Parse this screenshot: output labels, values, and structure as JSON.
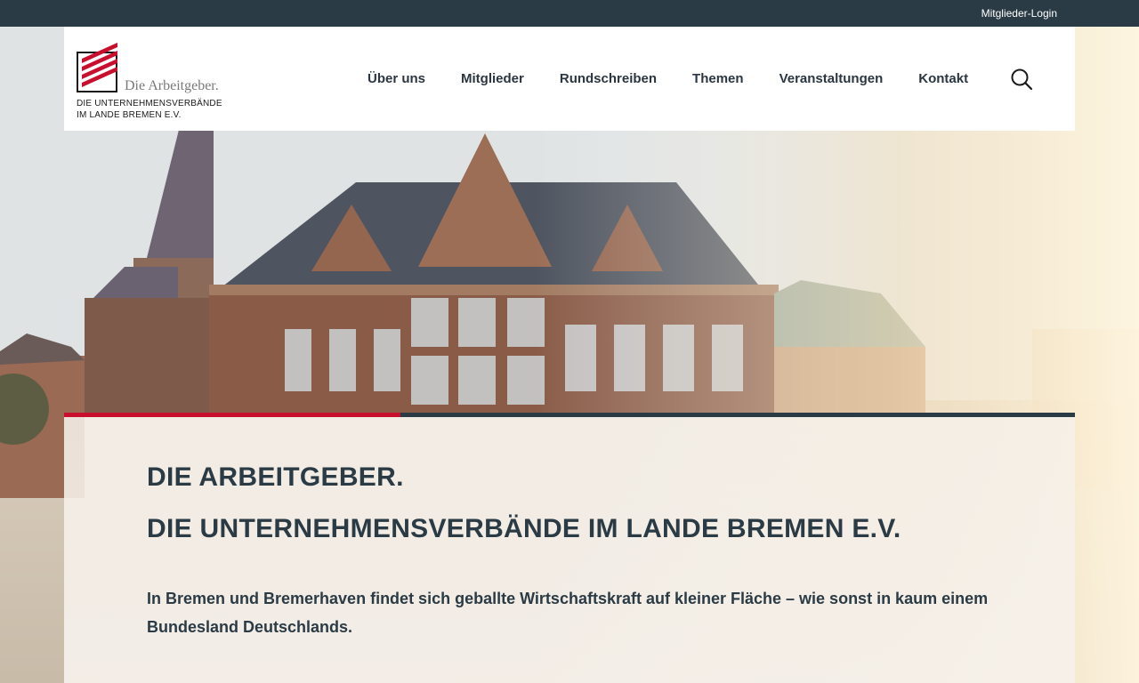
{
  "topbar": {
    "login_label": "Mitglieder-Login"
  },
  "logo": {
    "tagline": "Die Arbeitgeber.",
    "org_line1": "DIE UNTERNEHMENSVERBÄNDE",
    "org_line2": "IM LANDE BREMEN E.V."
  },
  "nav": {
    "items": [
      {
        "label": "Über uns"
      },
      {
        "label": "Mitglieder"
      },
      {
        "label": "Rundschreiben"
      },
      {
        "label": "Themen"
      },
      {
        "label": "Veranstaltungen"
      },
      {
        "label": "Kontakt"
      }
    ],
    "search_icon": "search-icon"
  },
  "hero": {
    "image": "bremen-town-hall-photo",
    "headline_line1": "DIE ARBEITGEBER.",
    "headline_line2": "DIE UNTERNEHMENSVERBÄNDE IM LANDE BREMEN E.V.",
    "intro": "In Bremen und Bremerhaven findet sich geballte Wirtschaftskraft auf kleiner Fläche – wie sonst in kaum einem Bundesland Deutschlands."
  },
  "colors": {
    "topbar": "#2b3b45",
    "accent_red": "#c8102e",
    "text_dark": "#2b3b45"
  }
}
